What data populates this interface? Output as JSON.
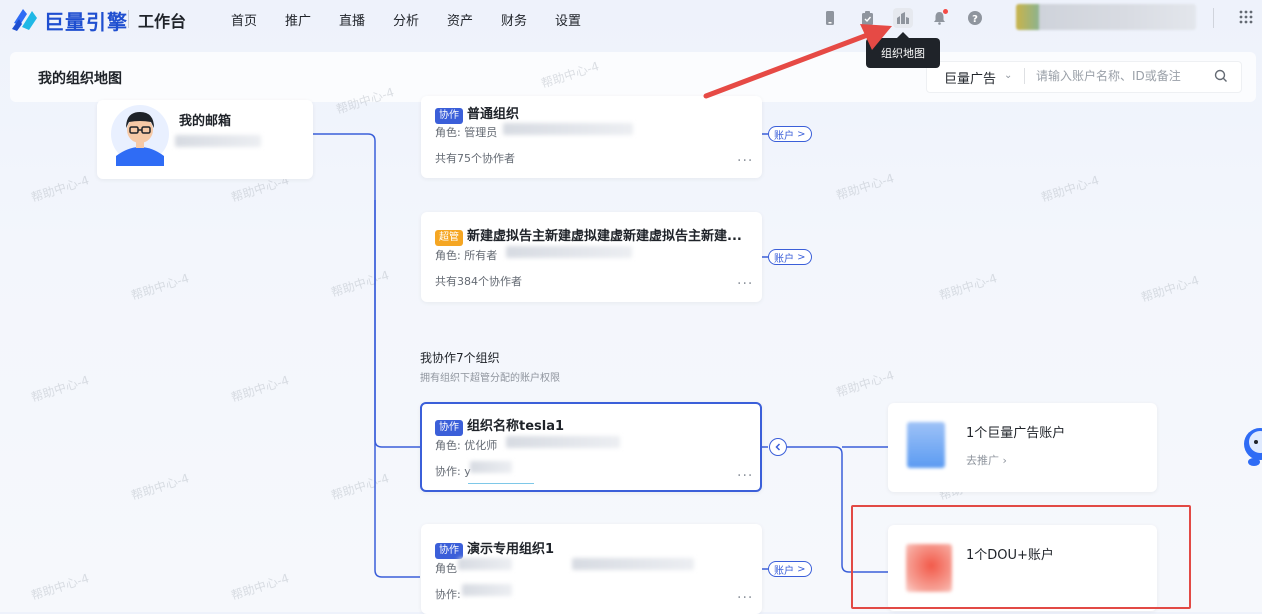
{
  "nav": {
    "brand": "巨量引擎",
    "workbench": "工作台",
    "items": [
      "首页",
      "推广",
      "直播",
      "分析",
      "资产",
      "财务",
      "设置"
    ]
  },
  "tooltip": "组织地图",
  "header": {
    "title": "我的组织地图",
    "select_value": "巨量广告",
    "search_placeholder": "请输入账户名称、ID或备注"
  },
  "me": {
    "name": "我的邮箱"
  },
  "orgs": [
    {
      "badge": "协作",
      "name": "普通组织",
      "role": "角色: 管理员",
      "footer": "共有75个协作者",
      "account_label": "账户"
    },
    {
      "badge": "超管",
      "name": "新建虚拟告主新建虚拟建虚新建虚拟告主新建...",
      "role": "角色: 所有者",
      "footer": "共有384个协作者",
      "account_label": "账户"
    },
    {
      "badge": "协作",
      "name": "组织名称tesla1",
      "role": "角色: 优化师",
      "footer": "协作: y"
    },
    {
      "badge": "协作",
      "name": "演示专用组织1",
      "role": "角色",
      "footer": "协作:",
      "account_label": "账户"
    }
  ],
  "section": {
    "title": "我协作7个组织",
    "subtitle": "拥有组织下超管分配的账户权限"
  },
  "accounts": [
    {
      "label": "1个巨量广告账户",
      "link": "去推广"
    },
    {
      "label": "1个DOU+账户"
    }
  ],
  "watermark_text": "帮助中心-4",
  "colors": {
    "accent": "#3b5fd9",
    "highlight": "#e24a45",
    "badge_super": "#f5a623"
  }
}
